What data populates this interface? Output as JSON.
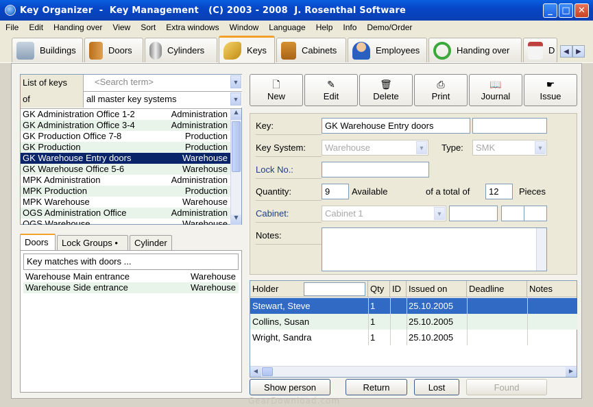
{
  "window": {
    "title": "Key Organizer  -  Key Management   (C) 2003 - 2008  J. Rosenthal Software"
  },
  "menu": [
    "File",
    "Edit",
    "Handing over",
    "View",
    "Sort",
    "Extra windows",
    "Window",
    "Language",
    "Help",
    "Info",
    "Demo/Order"
  ],
  "tabs": [
    {
      "label": "Buildings",
      "icon": "house-icon"
    },
    {
      "label": "Doors",
      "icon": "door-icon"
    },
    {
      "label": "Cylinders",
      "icon": "cylinder-icon"
    },
    {
      "label": "Keys",
      "icon": "key-icon"
    },
    {
      "label": "Cabinets",
      "icon": "cabinet-icon"
    },
    {
      "label": "Employees",
      "icon": "person-icon"
    },
    {
      "label": "Handing over",
      "icon": "arrows-icon"
    },
    {
      "label": "D",
      "icon": "calendar-icon"
    }
  ],
  "left": {
    "list_label": "List of keys",
    "search_placeholder": "<Search term>",
    "of_label": "of",
    "filter_value": "all master key systems",
    "keys": [
      {
        "name": "GK Administration Office 1-2",
        "location": "Administration"
      },
      {
        "name": "GK Administration Office 3-4",
        "location": "Administration"
      },
      {
        "name": "GK Production Office 7-8",
        "location": "Production"
      },
      {
        "name": "GK Production",
        "location": "Production"
      },
      {
        "name": "GK Warehouse Entry doors",
        "location": "Warehouse"
      },
      {
        "name": "GK Warehouse Office 5-6",
        "location": "Warehouse"
      },
      {
        "name": "MPK Administration",
        "location": "Administration"
      },
      {
        "name": "MPK Production",
        "location": "Production"
      },
      {
        "name": "MPK Warehouse",
        "location": "Warehouse"
      },
      {
        "name": "OGS Administration Office",
        "location": "Administration"
      },
      {
        "name": "OGS Warehouse",
        "location": "Warehouse"
      }
    ],
    "subtabs": [
      "Doors",
      "Lock Groups •",
      "Cylinder"
    ],
    "matches_header": "Key matches with doors ...",
    "matches": [
      {
        "name": "Warehouse Main entrance",
        "location": "Warehouse"
      },
      {
        "name": "Warehouse Side entrance",
        "location": "Warehouse"
      }
    ]
  },
  "toolbar": {
    "new": "New",
    "edit": "Edit",
    "delete": "Delete",
    "print": "Print",
    "journal": "Journal",
    "issue": "Issue"
  },
  "form": {
    "key_label": "Key:",
    "key_value": "GK Warehouse Entry doors",
    "key_system_label": "Key System:",
    "key_system_value": "Warehouse",
    "type_label": "Type:",
    "type_value": "SMK",
    "lock_no_label": "Lock No.:",
    "quantity_label": "Quantity:",
    "quantity_value": "9",
    "available_label": "Available",
    "total_label": "of a total of",
    "total_value": "12",
    "pieces_label": "Pieces",
    "cabinet_label": "Cabinet:",
    "cabinet_value": "Cabinet 1",
    "notes_label": "Notes:"
  },
  "grid": {
    "headers": {
      "holder": "Holder",
      "qty": "Qty",
      "id": "ID",
      "issued": "Issued on",
      "deadline": "Deadline",
      "notes": "Notes"
    },
    "rows": [
      {
        "holder": "Stewart, Steve",
        "qty": "1",
        "issued": "25.10.2005"
      },
      {
        "holder": "Collins, Susan",
        "qty": "1",
        "issued": "25.10.2005"
      },
      {
        "holder": "Wright, Sandra",
        "qty": "1",
        "issued": "25.10.2005"
      }
    ]
  },
  "bottom": {
    "show_person": "Show person",
    "return": "Return",
    "lost": "Lost",
    "found": "Found"
  },
  "watermark": "GearDownload.com"
}
